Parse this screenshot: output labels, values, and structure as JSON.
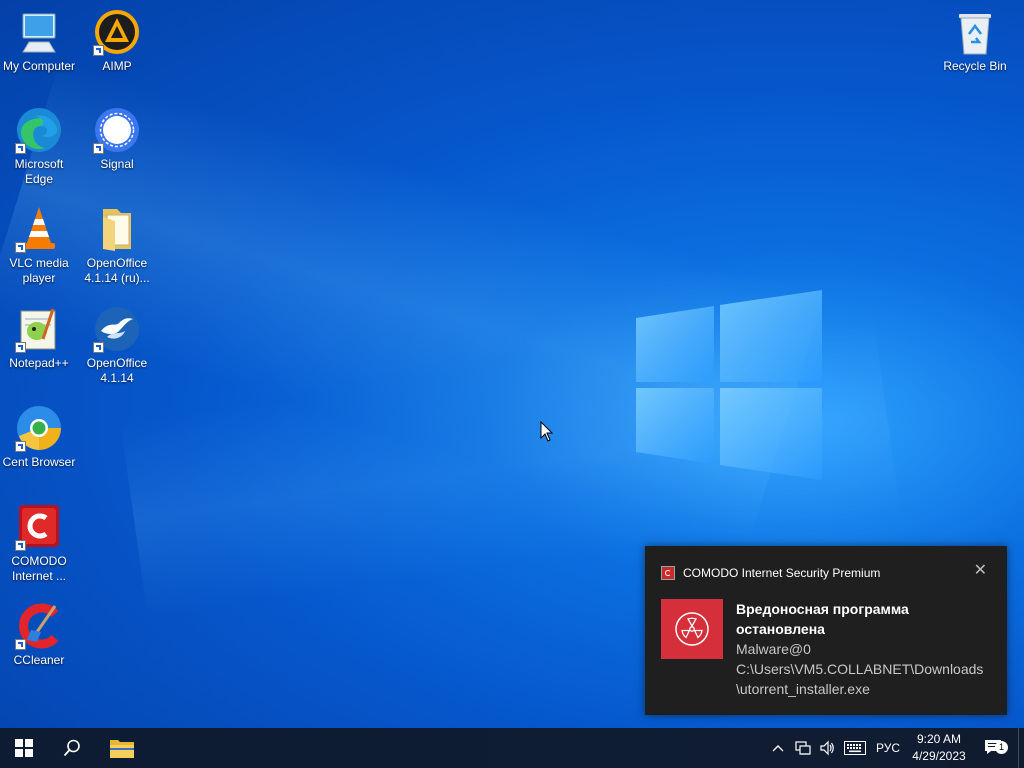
{
  "desktop_icons": {
    "my_computer": "My Computer",
    "aimp": "AIMP",
    "edge_line1": "Microsoft",
    "edge_line2": "Edge",
    "signal": "Signal",
    "vlc_line1": "VLC media",
    "vlc_line2": "player",
    "oo_folder_line1": "OpenOffice",
    "oo_folder_line2": "4.1.14 (ru)...",
    "notepadpp": "Notepad++",
    "oo_line1": "OpenOffice",
    "oo_line2": "4.1.14",
    "cent": "Cent Browser",
    "comodo_line1": "COMODO",
    "comodo_line2": "Internet ...",
    "ccleaner": "CCleaner",
    "recycle_bin": "Recycle Bin"
  },
  "notification": {
    "app_name": "COMODO Internet Security Premium",
    "close_glyph": "✕",
    "title_line1": "Вредоносная программа",
    "title_line2": "остановлена",
    "malware_name": "Malware@0",
    "path_line1": "C:\\Users\\VM5.COLLABNET\\Downloads",
    "path_line2": "\\utorrent_installer.exe"
  },
  "taskbar": {
    "language": "РУС",
    "time": "9:20 AM",
    "date": "4/29/2023",
    "notification_count": "1",
    "chevron": "^"
  },
  "colors": {
    "taskbar_bg": "#0f1d33",
    "toast_bg": "#1f1f1f",
    "alert_red": "#d62f3c",
    "desktop_blue": "#0657cc"
  }
}
